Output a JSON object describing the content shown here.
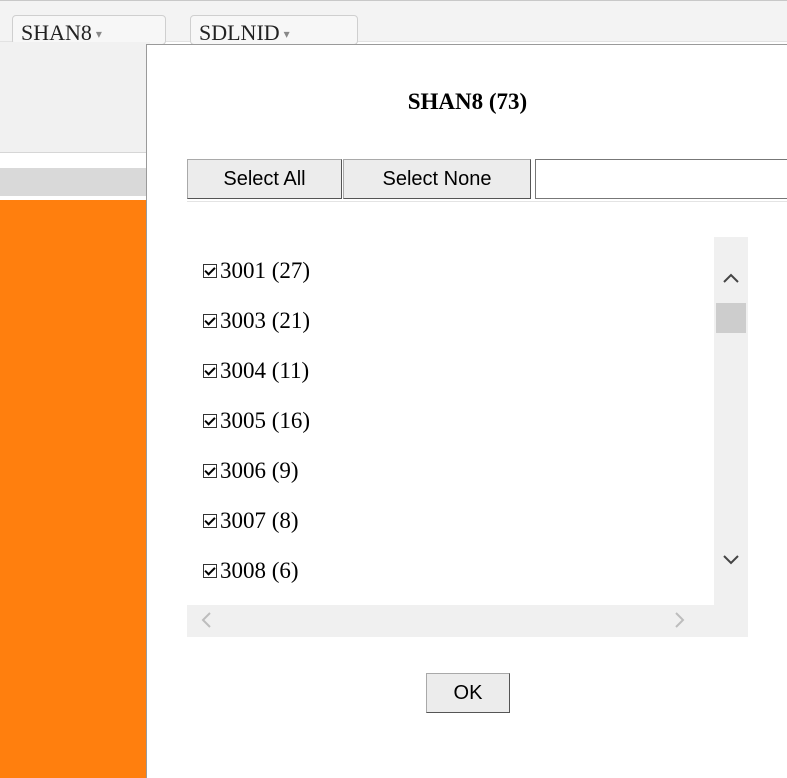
{
  "toolbar": {
    "fields": [
      {
        "label": "SHAN8",
        "arrow": "▾"
      },
      {
        "label": "SDLNID",
        "arrow": "▾"
      }
    ]
  },
  "popup": {
    "title": "SHAN8 (73)",
    "select_all_label": "Select All",
    "select_none_label": "Select None",
    "search_value": "",
    "items": [
      {
        "label": "3001 (27)",
        "checked": true
      },
      {
        "label": "3003 (21)",
        "checked": true
      },
      {
        "label": "3004 (11)",
        "checked": true
      },
      {
        "label": "3005 (16)",
        "checked": true
      },
      {
        "label": "3006 (9)",
        "checked": true
      },
      {
        "label": "3007 (8)",
        "checked": true
      },
      {
        "label": "3008 (6)",
        "checked": true
      }
    ],
    "ok_label": "OK"
  },
  "icons": {
    "scroll_up": "chevron-up-icon",
    "scroll_down": "chevron-down-icon",
    "scroll_left": "chevron-left-icon",
    "scroll_right": "chevron-right-icon"
  },
  "colors": {
    "chart_bar": "#ff7f0e"
  }
}
